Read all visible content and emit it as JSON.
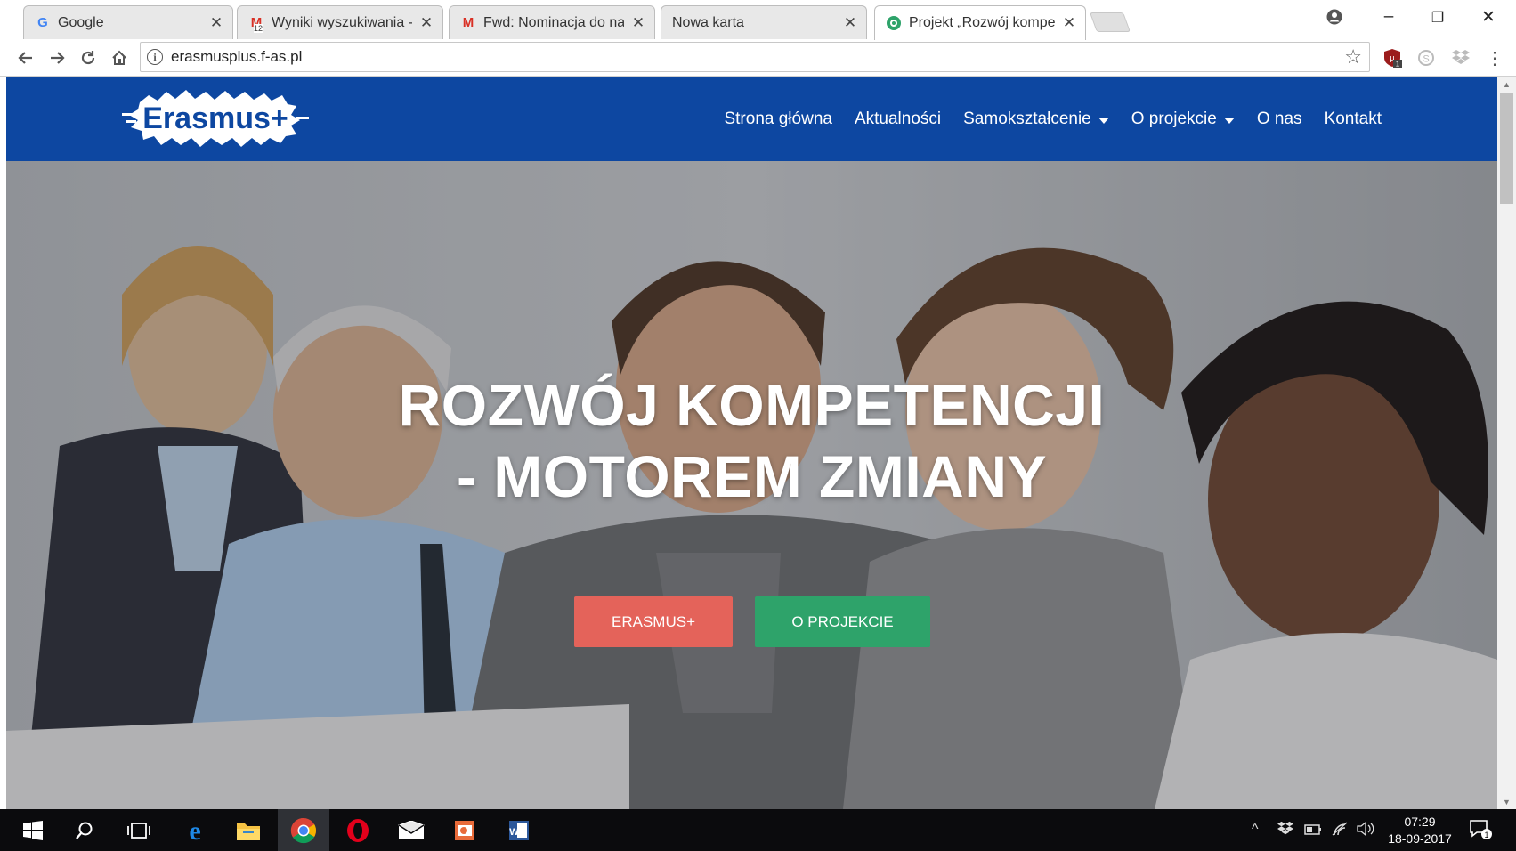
{
  "browser": {
    "tabs": [
      {
        "title": "Google",
        "favicon": "google-icon"
      },
      {
        "title": "Wyniki wyszukiwania - n",
        "favicon": "gmail-icon",
        "badge": "12"
      },
      {
        "title": "Fwd: Nominacja do nagr",
        "favicon": "gmail-icon"
      },
      {
        "title": "Nowa karta",
        "favicon": ""
      },
      {
        "title": "Projekt „Rozwój kompete",
        "favicon": "site-icon"
      }
    ],
    "url": "erasmusplus.f-as.pl",
    "extension_badge": "1"
  },
  "site": {
    "logo_text": "Erasmus+",
    "menu": [
      {
        "label": "Strona główna",
        "dropdown": false
      },
      {
        "label": "Aktualności",
        "dropdown": false
      },
      {
        "label": "Samokształcenie",
        "dropdown": true
      },
      {
        "label": "O projekcie",
        "dropdown": true
      },
      {
        "label": "O nas",
        "dropdown": false
      },
      {
        "label": "Kontakt",
        "dropdown": false
      }
    ],
    "hero": {
      "headline_line1": "ROZWÓJ KOMPETENCJI",
      "headline_line2": "- MOTOREM ZMIANY",
      "button_primary": "ERASMUS+",
      "button_secondary": "O PROJEKCIE"
    },
    "colors": {
      "nav": "#0d47a1",
      "button_primary": "#e4635a",
      "button_secondary": "#2ea36a"
    }
  },
  "taskbar": {
    "time": "07:29",
    "date": "18-09-2017",
    "notification_count": "1"
  }
}
